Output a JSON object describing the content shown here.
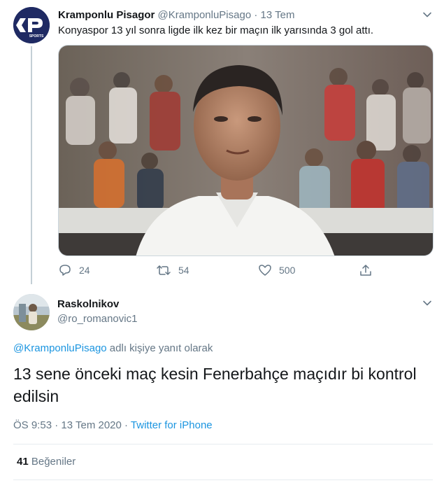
{
  "original_tweet": {
    "author_name": "Kramponlu Pisagor",
    "author_handle": "@KramponluPisago",
    "separator": "·",
    "date": "13 Tem",
    "text": "Konyaspor 13 yıl sonra ligde ilk kez bir maçın ilk yarısında 3 gol attı.",
    "avatar_logo_text": "SPORTS",
    "actions": {
      "replies": "24",
      "retweets": "54",
      "likes": "500"
    }
  },
  "reply_tweet": {
    "author_name": "Raskolnikov",
    "author_handle": "@ro_romanovic1",
    "reply_prefix_handle": "@KramponluPisago",
    "reply_suffix": " adlı kişiye yanıt olarak",
    "text": "13 sene önceki maç kesin Fenerbahçe maçıdır bi kontrol edilsin",
    "time": "ÖS 9:53",
    "separator": " · ",
    "date": "13 Tem 2020",
    "source": "Twitter for iPhone",
    "likes_count": "41",
    "likes_label": "Beğeniler"
  },
  "colors": {
    "link": "#1b95e0",
    "muted": "#657786",
    "text": "#14171a",
    "logo_bg": "#1f2a63"
  }
}
